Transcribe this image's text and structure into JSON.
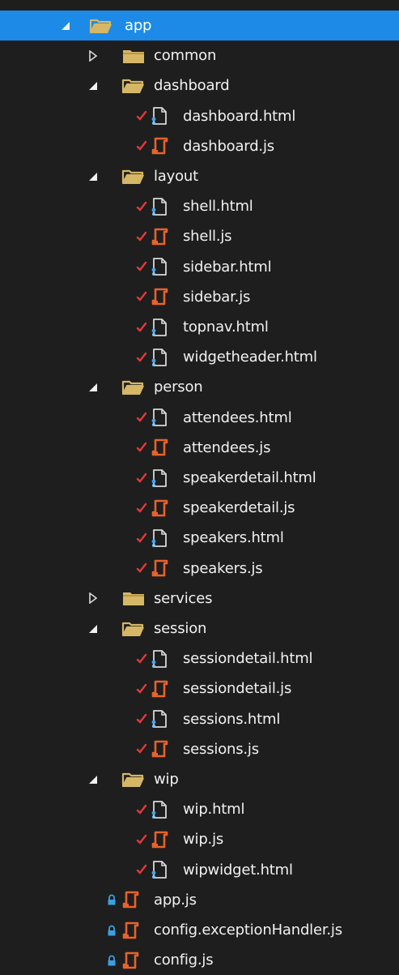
{
  "colors": {
    "background": "#1e1e1e",
    "selection": "#1c8ae6",
    "folder": "#d6b766",
    "js_file": "#e8622a",
    "html_file": "#d8d8d8",
    "pending_change": "#e23a3a",
    "lock": "#3aa0e0"
  },
  "tree": [
    {
      "label": "app",
      "level": 0,
      "kind": "folder",
      "state": "expanded",
      "selected": true,
      "badge": "none"
    },
    {
      "label": "common",
      "level": 1,
      "kind": "folder",
      "state": "collapsed",
      "badge": "none"
    },
    {
      "label": "dashboard",
      "level": 1,
      "kind": "folder",
      "state": "expanded",
      "badge": "none"
    },
    {
      "label": "dashboard.html",
      "level": 2,
      "kind": "html",
      "badge": "check"
    },
    {
      "label": "dashboard.js",
      "level": 2,
      "kind": "js",
      "badge": "check"
    },
    {
      "label": "layout",
      "level": 1,
      "kind": "folder",
      "state": "expanded",
      "badge": "none"
    },
    {
      "label": "shell.html",
      "level": 2,
      "kind": "html",
      "badge": "check"
    },
    {
      "label": "shell.js",
      "level": 2,
      "kind": "js",
      "badge": "check"
    },
    {
      "label": "sidebar.html",
      "level": 2,
      "kind": "html",
      "badge": "check"
    },
    {
      "label": "sidebar.js",
      "level": 2,
      "kind": "js",
      "badge": "check"
    },
    {
      "label": "topnav.html",
      "level": 2,
      "kind": "html",
      "badge": "check"
    },
    {
      "label": "widgetheader.html",
      "level": 2,
      "kind": "html",
      "badge": "check"
    },
    {
      "label": "person",
      "level": 1,
      "kind": "folder",
      "state": "expanded",
      "badge": "none"
    },
    {
      "label": "attendees.html",
      "level": 2,
      "kind": "html",
      "badge": "check"
    },
    {
      "label": "attendees.js",
      "level": 2,
      "kind": "js",
      "badge": "check"
    },
    {
      "label": "speakerdetail.html",
      "level": 2,
      "kind": "html",
      "badge": "check"
    },
    {
      "label": "speakerdetail.js",
      "level": 2,
      "kind": "js",
      "badge": "check"
    },
    {
      "label": "speakers.html",
      "level": 2,
      "kind": "html",
      "badge": "check"
    },
    {
      "label": "speakers.js",
      "level": 2,
      "kind": "js",
      "badge": "check"
    },
    {
      "label": "services",
      "level": 1,
      "kind": "folder",
      "state": "collapsed",
      "badge": "none"
    },
    {
      "label": "session",
      "level": 1,
      "kind": "folder",
      "state": "expanded",
      "badge": "none"
    },
    {
      "label": "sessiondetail.html",
      "level": 2,
      "kind": "html",
      "badge": "check"
    },
    {
      "label": "sessiondetail.js",
      "level": 2,
      "kind": "js",
      "badge": "check"
    },
    {
      "label": "sessions.html",
      "level": 2,
      "kind": "html",
      "badge": "check"
    },
    {
      "label": "sessions.js",
      "level": 2,
      "kind": "js",
      "badge": "check"
    },
    {
      "label": "wip",
      "level": 1,
      "kind": "folder",
      "state": "expanded",
      "badge": "none"
    },
    {
      "label": "wip.html",
      "level": 2,
      "kind": "html",
      "badge": "check"
    },
    {
      "label": "wip.js",
      "level": 2,
      "kind": "js",
      "badge": "check"
    },
    {
      "label": "wipwidget.html",
      "level": 2,
      "kind": "html",
      "badge": "check"
    },
    {
      "label": "app.js",
      "level": 1,
      "kind": "js",
      "badge": "lock"
    },
    {
      "label": "config.exceptionHandler.js",
      "level": 1,
      "kind": "js",
      "badge": "lock"
    },
    {
      "label": "config.js",
      "level": 1,
      "kind": "js",
      "badge": "lock"
    }
  ]
}
